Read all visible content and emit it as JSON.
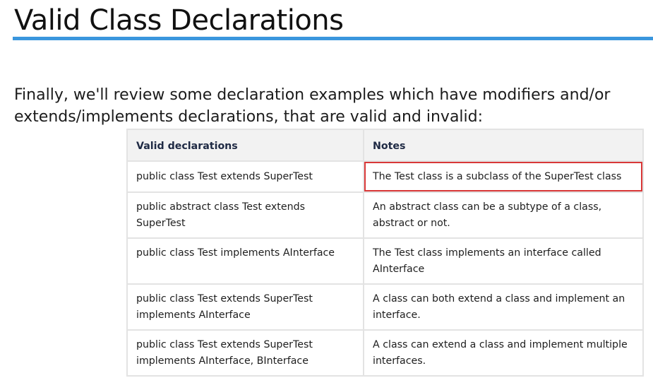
{
  "page": {
    "title": "Valid Class Declarations",
    "intro": "Finally, we'll review some declaration examples which have modifiers and/or extends/implements declarations, that are valid and invalid:",
    "accent_color": "#3a96dd",
    "highlight_color": "#d93838"
  },
  "table": {
    "headers": [
      "Valid declarations",
      "Notes"
    ],
    "rows": [
      {
        "declaration": "public class Test extends SuperTest",
        "note": "The Test class is a subclass of the SuperTest class",
        "note_highlighted": true
      },
      {
        "declaration": "public abstract class Test extends SuperTest",
        "note": "An abstract class can be a subtype of a class, abstract or not.",
        "note_highlighted": false
      },
      {
        "declaration": "public class Test implements AInterface",
        "note": "The Test class implements an interface called AInterface",
        "note_highlighted": false
      },
      {
        "declaration": "public class Test extends SuperTest implements AInterface",
        "note": "A class can both extend a class and implement an interface.",
        "note_highlighted": false
      },
      {
        "declaration": "public class Test extends SuperTest implements AInterface, BInterface",
        "note": "A class can extend a class and implement multiple interfaces.",
        "note_highlighted": false
      }
    ]
  }
}
